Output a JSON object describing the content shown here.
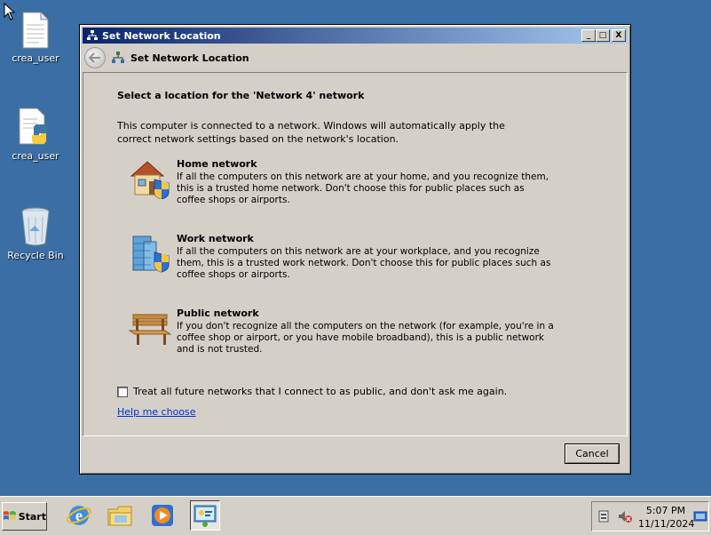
{
  "desktop": {
    "icons": [
      {
        "label": "crea_user",
        "icon": "text-file-icon"
      },
      {
        "label": "crea_user",
        "icon": "python-file-icon"
      },
      {
        "label": "Recycle Bin",
        "icon": "recycle-bin-icon"
      }
    ]
  },
  "window": {
    "title": "Set Network Location",
    "nav_title": "Set Network Location",
    "heading": "Select a location for the 'Network  4' network",
    "intro": "This computer is connected to a network. Windows will automatically apply the correct network settings based on the network's location.",
    "options": [
      {
        "title": "Home network",
        "description": "If all the computers on this network are at your home, and you recognize them, this is a trusted home network.  Don't choose this for public places such as coffee shops or airports.",
        "icon": "home-network-icon"
      },
      {
        "title": "Work network",
        "description": "If all the computers on this network are at your workplace, and you recognize them, this is a trusted work network.  Don't choose this for public places such as coffee shops or airports.",
        "icon": "work-network-icon"
      },
      {
        "title": "Public network",
        "description": "If you don't recognize all the computers on the network (for example, you're in a coffee shop or airport, or you have mobile broadband), this is a public network and is not trusted.",
        "icon": "public-network-icon"
      }
    ],
    "checkbox_label": "Treat all future networks that I connect to as public, and don't ask me again.",
    "checkbox_checked": false,
    "help_link": "Help me choose",
    "cancel_label": "Cancel",
    "titlebar_buttons": {
      "minimize": "_",
      "maximize": "□",
      "close": "X"
    }
  },
  "taskbar": {
    "start_label": "Start",
    "apps": [
      "internet-explorer-icon",
      "windows-explorer-icon",
      "media-player-icon",
      "network-dialog-icon"
    ],
    "clock_time": "5:07 PM",
    "clock_date": "11/11/2024"
  },
  "colors": {
    "desktop": "#3a6ea5",
    "titlebar_start": "#0a246a",
    "titlebar_end": "#a6caf0",
    "face": "#d4d0c8",
    "link": "#0033cc"
  }
}
